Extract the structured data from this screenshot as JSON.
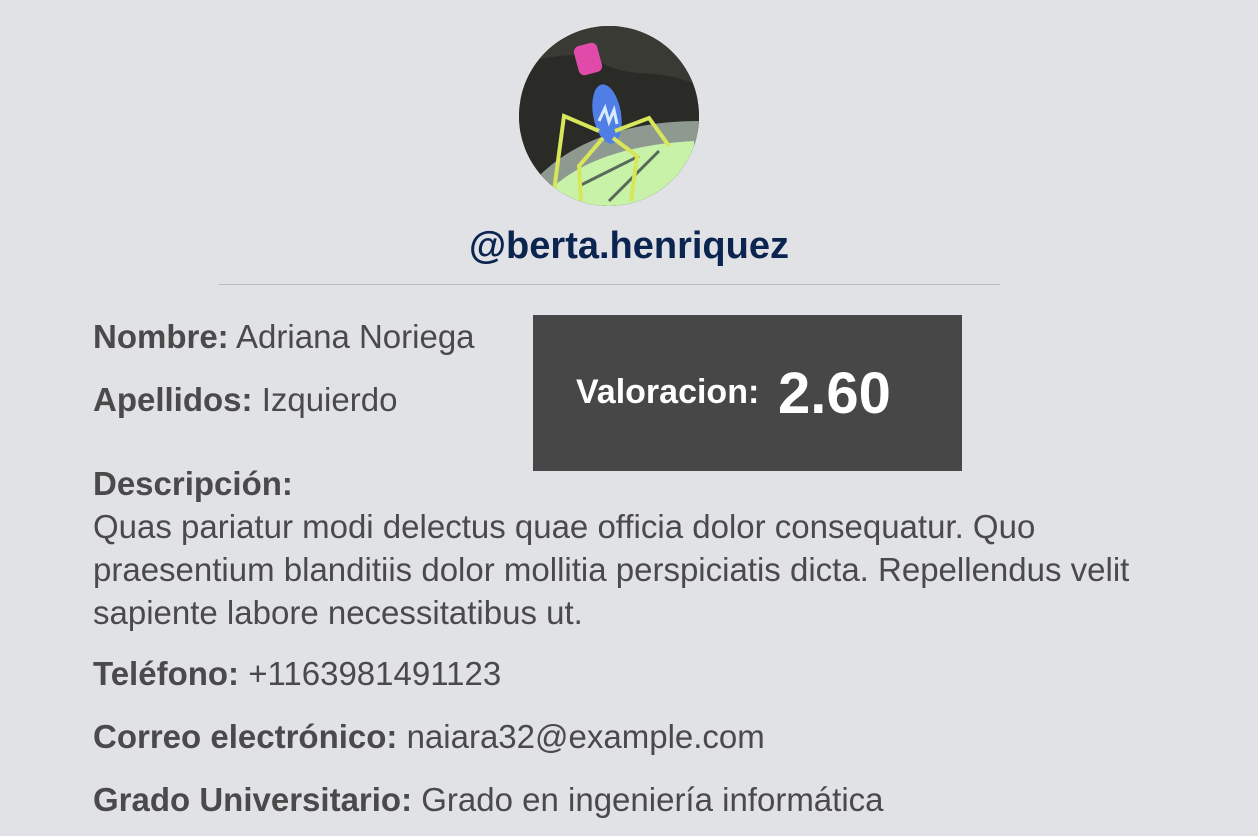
{
  "profile": {
    "username": "@berta.henriquez",
    "avatar_icon": "avatar-image-icon"
  },
  "fields": {
    "nombre": {
      "label": "Nombre:",
      "value": "Adriana Noriega"
    },
    "apellidos": {
      "label": "Apellidos:",
      "value": "Izquierdo"
    },
    "descripcion": {
      "label": "Descripción:",
      "value": "Quas pariatur modi delectus quae officia dolor consequatur. Quo praesentium blanditiis dolor mollitia perspiciatis dicta. Repellendus velit sapiente labore necessitatibus ut."
    },
    "telefono": {
      "label": "Teléfono:",
      "value": "+1163981491123"
    },
    "correo": {
      "label": "Correo electrónico:",
      "value": "naiara32@example.com"
    },
    "grado": {
      "label": "Grado Universitario:",
      "value": "Grado en ingeniería informática"
    }
  },
  "rating": {
    "label": "Valoracion:",
    "value": "2.60"
  },
  "colors": {
    "background": "#e1e2e6",
    "username": "#0b2450",
    "rating_box": "#474747",
    "text": "#4a4a4a"
  }
}
